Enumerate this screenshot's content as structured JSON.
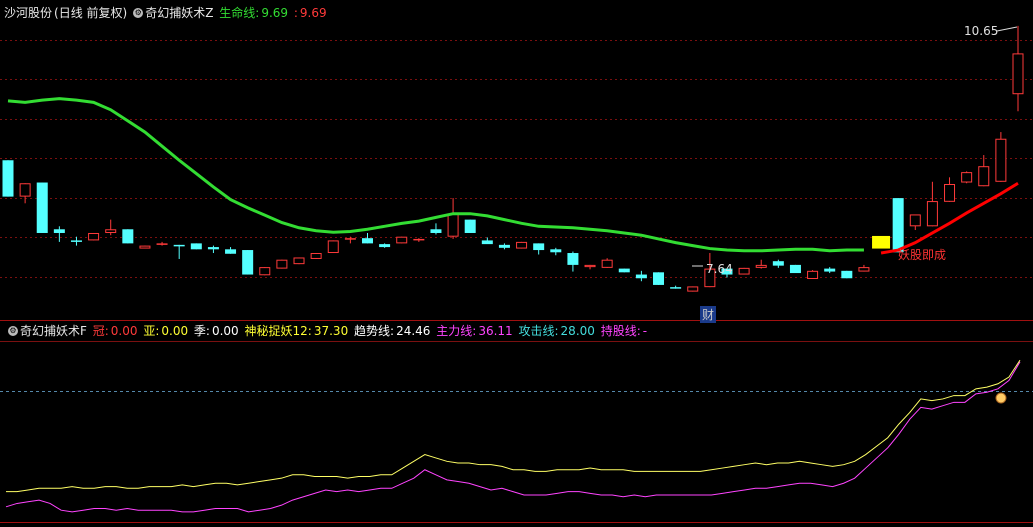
{
  "top_panel": {
    "stock_name": "沙河股份",
    "period_label": "(日线 前复权)",
    "indicator_name": "奇幻捕妖术Z",
    "life_line_label": "生命线:",
    "life_line_value": "9.69",
    "sep": ":",
    "sep_value": "9.69",
    "high_label": "10.65",
    "low_label": "7.64",
    "demon_label": "妖股即成",
    "fin_marker": "财"
  },
  "bottom_panel": {
    "indicator_name": "奇幻捕妖术F",
    "guan_label": "冠:",
    "guan_value": "0.00",
    "ya_label": "亚:",
    "ya_value": "0.00",
    "ji_label": "季:",
    "ji_value": "0.00",
    "mystery_label": "神秘捉妖12:",
    "mystery_value": "37.30",
    "trend_label": "趋势线:",
    "trend_value": "24.46",
    "main_label": "主力线:",
    "main_value": "36.11",
    "attack_label": "攻击线:",
    "attack_value": "28.00",
    "hold_label": "持股线:",
    "hold_value": "-"
  },
  "colors": {
    "up": "#ff3a3a",
    "down": "#54ffff",
    "life_line": "#33dd33",
    "rising_line": "#ff0000",
    "highlight": "#ffff00",
    "trend": "#ffff66",
    "main": "#ff44ff",
    "grid": "#7a1010"
  },
  "chart_data": [
    {
      "type": "candlestick",
      "title": "奇幻捕妖术Z",
      "ohlc": [
        [
          8.89,
          8.89,
          8.4,
          8.4
        ],
        [
          8.4,
          8.58,
          8.31,
          8.58
        ],
        [
          8.59,
          8.59,
          7.91,
          7.91
        ],
        [
          7.96,
          8.0,
          7.79,
          7.91
        ],
        [
          7.81,
          7.86,
          7.74,
          7.79
        ],
        [
          7.81,
          7.91,
          7.81,
          7.91
        ],
        [
          7.91,
          8.09,
          7.88,
          7.96
        ],
        [
          7.96,
          7.96,
          7.77,
          7.77
        ],
        [
          7.7,
          7.74,
          7.71,
          7.74
        ],
        [
          7.76,
          7.79,
          7.74,
          7.77
        ],
        [
          7.75,
          7.75,
          7.56,
          7.74
        ],
        [
          7.77,
          7.77,
          7.69,
          7.69
        ],
        [
          7.72,
          7.74,
          7.64,
          7.69
        ],
        [
          7.69,
          7.72,
          7.63,
          7.63
        ],
        [
          7.68,
          7.68,
          7.35,
          7.35
        ],
        [
          7.34,
          7.45,
          7.34,
          7.45
        ],
        [
          7.43,
          7.55,
          7.43,
          7.55
        ],
        [
          7.49,
          7.58,
          7.49,
          7.58
        ],
        [
          7.56,
          7.64,
          7.56,
          7.64
        ],
        [
          7.64,
          7.81,
          7.64,
          7.81
        ],
        [
          7.82,
          7.86,
          7.77,
          7.84
        ],
        [
          7.84,
          7.91,
          7.77,
          7.77
        ],
        [
          7.76,
          7.77,
          7.71,
          7.72
        ],
        [
          7.77,
          7.86,
          7.77,
          7.86
        ],
        [
          7.81,
          7.84,
          7.79,
          7.83
        ],
        [
          7.96,
          8.04,
          7.89,
          7.91
        ],
        [
          7.86,
          8.38,
          7.83,
          8.17
        ],
        [
          8.09,
          8.09,
          7.91,
          7.91
        ],
        [
          7.81,
          7.85,
          7.77,
          7.76
        ],
        [
          7.75,
          7.77,
          7.69,
          7.71
        ],
        [
          7.7,
          7.79,
          7.7,
          7.79
        ],
        [
          7.77,
          7.77,
          7.62,
          7.68
        ],
        [
          7.69,
          7.71,
          7.61,
          7.65
        ],
        [
          7.64,
          7.66,
          7.39,
          7.48
        ],
        [
          7.45,
          7.48,
          7.42,
          7.48
        ],
        [
          7.44,
          7.57,
          7.44,
          7.55
        ],
        [
          7.43,
          7.43,
          7.38,
          7.38
        ],
        [
          7.35,
          7.4,
          7.26,
          7.3
        ],
        [
          7.38,
          7.38,
          7.21,
          7.21
        ],
        [
          7.18,
          7.2,
          7.16,
          7.16
        ],
        [
          7.12,
          7.19,
          7.12,
          7.19
        ],
        [
          7.18,
          7.64,
          7.18,
          7.43
        ],
        [
          7.43,
          7.43,
          7.31,
          7.35
        ],
        [
          7.35,
          7.44,
          7.35,
          7.44
        ],
        [
          7.44,
          7.55,
          7.43,
          7.48
        ],
        [
          7.53,
          7.55,
          7.44,
          7.47
        ],
        [
          7.48,
          7.48,
          7.39,
          7.37
        ],
        [
          7.29,
          7.41,
          7.29,
          7.4
        ],
        [
          7.43,
          7.45,
          7.37,
          7.39
        ],
        [
          7.4,
          7.4,
          7.3,
          7.3
        ],
        [
          7.39,
          7.48,
          7.39,
          7.45
        ],
        [
          7.7,
          8.04,
          7.62,
          7.87
        ],
        [
          8.38,
          8.38,
          7.65,
          7.65
        ],
        [
          8.0,
          8.09,
          7.95,
          8.16
        ],
        [
          8.0,
          8.6,
          8.0,
          8.34
        ],
        [
          8.33,
          8.66,
          8.33,
          8.57
        ],
        [
          8.59,
          8.74,
          8.58,
          8.73
        ],
        [
          8.54,
          8.96,
          8.54,
          8.81
        ],
        [
          8.6,
          9.27,
          8.6,
          9.18
        ],
        [
          9.78,
          10.7,
          9.55,
          10.33
        ]
      ],
      "life_line": [
        9.69,
        9.67,
        9.7,
        9.72,
        9.7,
        9.67,
        9.57,
        9.42,
        9.27,
        9.08,
        8.89,
        8.71,
        8.53,
        8.36,
        8.25,
        8.15,
        8.05,
        7.98,
        7.94,
        7.92,
        7.93,
        7.96,
        8.0,
        8.04,
        8.07,
        8.12,
        8.17,
        8.17,
        8.14,
        8.09,
        8.04,
        8.0,
        7.99,
        7.98,
        7.96,
        7.94,
        7.91,
        7.88,
        7.83,
        7.78,
        7.74,
        7.7,
        7.68,
        7.67,
        7.67,
        7.68,
        7.69,
        7.69,
        7.67,
        7.68,
        7.68
      ],
      "rising_line": [
        7.64,
        7.68,
        7.78,
        7.91,
        8.04,
        8.18,
        8.31,
        8.44,
        8.58
      ],
      "highlight_bar_index": 51,
      "ylim": [
        6.98,
        10.78
      ],
      "annotations": [
        "10.65",
        "7.64",
        "妖股即成",
        "财"
      ]
    },
    {
      "type": "line",
      "title": "奇幻捕妖术F",
      "series": [
        {
          "name": "趋势线",
          "values": [
            13,
            13,
            14,
            15,
            15,
            15,
            16,
            15,
            15,
            16,
            16,
            15,
            15,
            16,
            16,
            16,
            17,
            16,
            17,
            18,
            18,
            17,
            18,
            19,
            20,
            21,
            23,
            23,
            22,
            22,
            22,
            21,
            22,
            22,
            23,
            23,
            27,
            31,
            35,
            33,
            31,
            30,
            30,
            29,
            29,
            28,
            26,
            26,
            25,
            25,
            26,
            26,
            26,
            27,
            26,
            26,
            26,
            25,
            25,
            25,
            25,
            25,
            25,
            25,
            26,
            27,
            28,
            29,
            30,
            29,
            30,
            30,
            31,
            30,
            29,
            28,
            29,
            31,
            35,
            40,
            45,
            53,
            60,
            68,
            67,
            68,
            70,
            70,
            74,
            75,
            77,
            81,
            91
          ]
        },
        {
          "name": "主力线",
          "values": [
            4,
            6,
            7,
            8,
            6,
            2,
            1,
            2,
            3,
            3,
            2,
            3,
            2,
            2,
            2,
            2,
            1,
            1,
            2,
            3,
            3,
            3,
            1,
            2,
            3,
            5,
            8,
            10,
            12,
            14,
            13,
            14,
            13,
            14,
            15,
            15,
            18,
            21,
            26,
            23,
            20,
            19,
            18,
            16,
            14,
            15,
            13,
            11,
            11,
            11,
            12,
            13,
            13,
            12,
            11,
            11,
            10,
            11,
            10,
            11,
            11,
            11,
            11,
            11,
            11,
            12,
            13,
            14,
            15,
            15,
            16,
            17,
            18,
            18,
            17,
            16,
            18,
            21,
            27,
            33,
            39,
            47,
            56,
            63,
            62,
            64,
            66,
            66,
            71,
            72,
            74,
            79,
            90
          ]
        }
      ],
      "ylim": [
        -5,
        100
      ]
    }
  ]
}
